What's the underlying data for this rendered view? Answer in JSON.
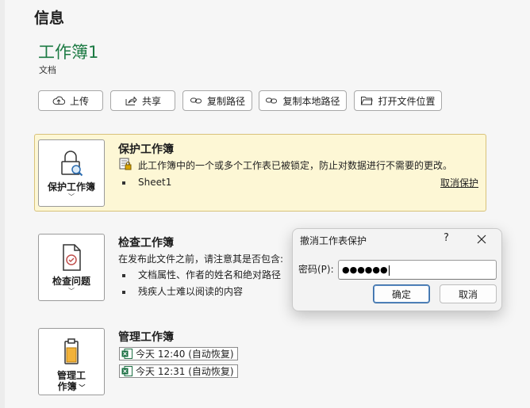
{
  "page_title": "信息",
  "document": {
    "name": "工作簿1",
    "type": "文档"
  },
  "actions": [
    {
      "label": "上传",
      "icon": "upload-icon"
    },
    {
      "label": "共享",
      "icon": "share-icon"
    },
    {
      "label": "复制路径",
      "icon": "link-icon"
    },
    {
      "label": "复制本地路径",
      "icon": "link-icon"
    },
    {
      "label": "打开文件位置",
      "icon": "folder-icon"
    }
  ],
  "protect": {
    "button_label": "保护工作簿",
    "title": "保护工作簿",
    "description": "此工作簿中的一个或多个工作表已被锁定，防止对数据进行不需要的更改。",
    "sheet": "Sheet1",
    "unprotect_link": "取消保护",
    "panel_color": "#fdf7d5"
  },
  "inspect": {
    "button_label": "检查问题",
    "title": "检查工作簿",
    "description": "在发布此文件之前，请注意其是否包含:",
    "bullets": [
      "文档属性、作者的姓名和绝对路径",
      "残疾人士难以阅读的内容"
    ]
  },
  "manage": {
    "button_label_line1": "管理工",
    "button_label_line2": "作簿",
    "title": "管理工作簿",
    "versions": [
      "今天 12:40 (自动恢复)",
      "今天 12:31 (自动恢复)"
    ]
  },
  "dialog": {
    "title": "撤消工作表保护",
    "help": "?",
    "password_label": "密码(P):",
    "password_value": "●●●●●●",
    "ok_label": "确定",
    "cancel_label": "取消"
  },
  "colors": {
    "accent_green": "#1c7a43",
    "excel_green": "#1d7044"
  }
}
